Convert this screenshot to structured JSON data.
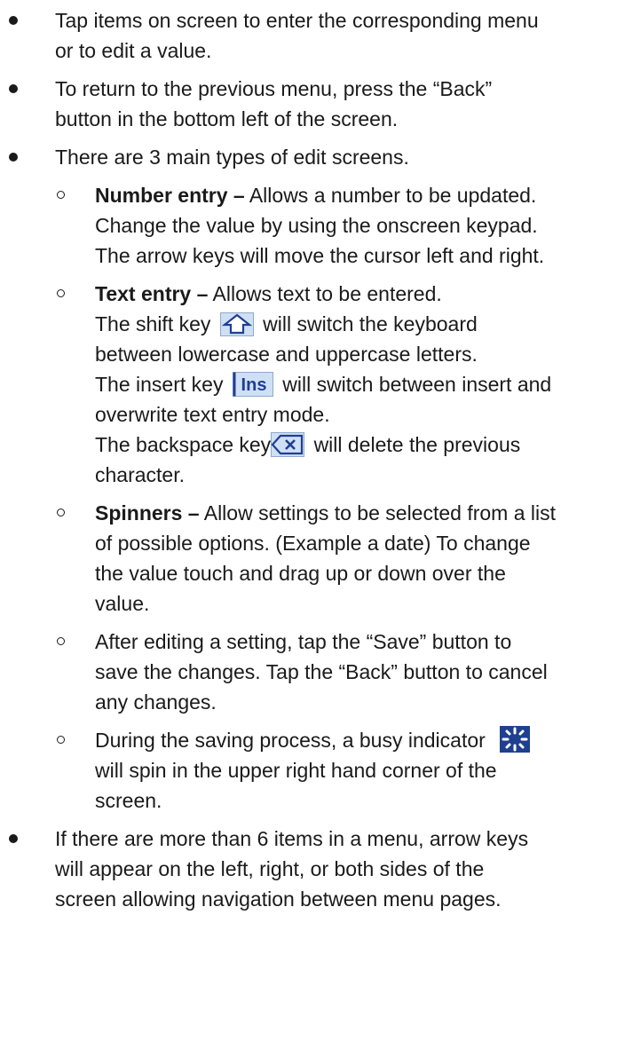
{
  "items": [
    {
      "lines": [
        "Tap items on screen to enter the corresponding menu",
        "or to edit a value."
      ]
    },
    {
      "lines": [
        "To return to the previous menu, press the “Back”",
        "button in the bottom left of the screen."
      ]
    },
    {
      "lines": [
        "There are 3 main types of edit screens."
      ],
      "subitems": [
        {
          "term": "Number entry –",
          "first": " Allows a number to be updated.",
          "lines": [
            "Change the value by using the onscreen keypad.",
            "The arrow keys will move the cursor left and right."
          ]
        },
        {
          "term": "Text entry –",
          "first": " Allows text to be entered.",
          "shift": {
            "pre": "The shift key",
            "post": "will switch the keyboard",
            "cont": "between lowercase and uppercase letters.",
            "icon": "shift-key-icon"
          },
          "insert": {
            "pre": "The insert key",
            "post": "will switch between insert and",
            "cont": "overwrite text entry mode.",
            "icon_text": "Ins"
          },
          "backspace": {
            "pre": "The backspace key",
            "post": "will delete the previous",
            "cont": "character.",
            "icon": "backspace-key-icon"
          }
        },
        {
          "term": "Spinners –",
          "first": " Allow settings to be selected from a list",
          "lines": [
            "of possible options.  (Example a date)  To change",
            "the value touch and drag up or down over the",
            "value."
          ]
        },
        {
          "lines": [
            "After editing a setting, tap the “Save” button to",
            "save the changes.  Tap the “Back” button to cancel",
            "any changes."
          ]
        },
        {
          "busy": {
            "pre": "During the saving process, a busy indicator",
            "cont1": "will spin in the upper right hand corner of the",
            "cont2": "screen.",
            "icon": "busy-indicator-icon"
          }
        }
      ]
    },
    {
      "lines": [
        "If there are more than 6 items in a menu, arrow keys",
        "will appear on the left, right, or both sides of the",
        "screen allowing navigation between menu pages."
      ]
    }
  ],
  "colors": {
    "text": "#1a1a1a",
    "icon_blue": "#1f3f8f",
    "icon_light": "#cfe0f5"
  }
}
